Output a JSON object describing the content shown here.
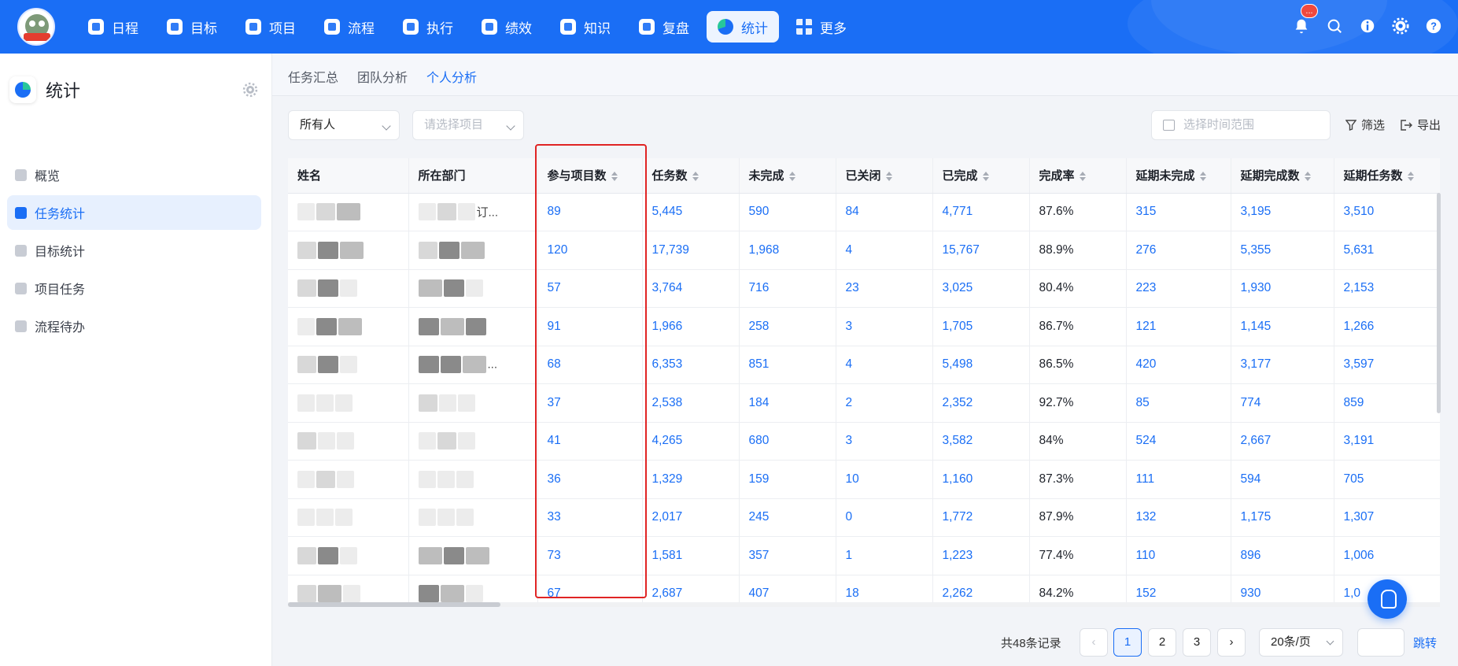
{
  "nav": {
    "items": [
      {
        "label": "日程",
        "icon": "calendar-icon"
      },
      {
        "label": "目标",
        "icon": "target-icon"
      },
      {
        "label": "项目",
        "icon": "cube-icon"
      },
      {
        "label": "流程",
        "icon": "flow-icon"
      },
      {
        "label": "执行",
        "icon": "checklist-icon"
      },
      {
        "label": "绩效",
        "icon": "performance-icon"
      },
      {
        "label": "知识",
        "icon": "book-icon"
      },
      {
        "label": "复盘",
        "icon": "review-icon"
      },
      {
        "label": "统计",
        "icon": "pie-chart-icon",
        "active": true
      },
      {
        "label": "更多",
        "icon": "grid-icon"
      }
    ],
    "badge": "..."
  },
  "sidebar": {
    "title": "统计",
    "items": [
      {
        "label": "概览"
      },
      {
        "label": "任务统计",
        "active": true
      },
      {
        "label": "目标统计"
      },
      {
        "label": "项目任务"
      },
      {
        "label": "流程待办"
      }
    ]
  },
  "tabs": [
    "任务汇总",
    "团队分析",
    "个人分析"
  ],
  "filters": {
    "person": "所有人",
    "project_placeholder": "请选择项目",
    "date_placeholder": "选择时间范围",
    "filter_label": "筛选",
    "export_label": "导出"
  },
  "table": {
    "columns": [
      "姓名",
      "所在部门",
      "参与项目数",
      "任务数",
      "未完成",
      "已关闭",
      "已完成",
      "完成率",
      "延期未完成",
      "延期完成数",
      "延期任务数"
    ],
    "rows": [
      {
        "dept_suffix": "订...",
        "projects": "89",
        "tasks": "5,445",
        "unfinished": "590",
        "closed": "84",
        "done": "4,771",
        "rate": "87.6%",
        "delay_unfinished": "315",
        "delay_done": "3,195",
        "delay_tasks": "3,510"
      },
      {
        "dept_suffix": "",
        "projects": "120",
        "tasks": "17,739",
        "unfinished": "1,968",
        "closed": "4",
        "done": "15,767",
        "rate": "88.9%",
        "delay_unfinished": "276",
        "delay_done": "5,355",
        "delay_tasks": "5,631"
      },
      {
        "dept_suffix": "",
        "projects": "57",
        "tasks": "3,764",
        "unfinished": "716",
        "closed": "23",
        "done": "3,025",
        "rate": "80.4%",
        "delay_unfinished": "223",
        "delay_done": "1,930",
        "delay_tasks": "2,153"
      },
      {
        "dept_suffix": "",
        "projects": "91",
        "tasks": "1,966",
        "unfinished": "258",
        "closed": "3",
        "done": "1,705",
        "rate": "86.7%",
        "delay_unfinished": "121",
        "delay_done": "1,145",
        "delay_tasks": "1,266"
      },
      {
        "dept_suffix": "...",
        "projects": "68",
        "tasks": "6,353",
        "unfinished": "851",
        "closed": "4",
        "done": "5,498",
        "rate": "86.5%",
        "delay_unfinished": "420",
        "delay_done": "3,177",
        "delay_tasks": "3,597"
      },
      {
        "dept_suffix": "",
        "projects": "37",
        "tasks": "2,538",
        "unfinished": "184",
        "closed": "2",
        "done": "2,352",
        "rate": "92.7%",
        "delay_unfinished": "85",
        "delay_done": "774",
        "delay_tasks": "859"
      },
      {
        "dept_suffix": "",
        "projects": "41",
        "tasks": "4,265",
        "unfinished": "680",
        "closed": "3",
        "done": "3,582",
        "rate": "84%",
        "delay_unfinished": "524",
        "delay_done": "2,667",
        "delay_tasks": "3,191"
      },
      {
        "dept_suffix": "",
        "projects": "36",
        "tasks": "1,329",
        "unfinished": "159",
        "closed": "10",
        "done": "1,160",
        "rate": "87.3%",
        "delay_unfinished": "111",
        "delay_done": "594",
        "delay_tasks": "705"
      },
      {
        "dept_suffix": "",
        "projects": "33",
        "tasks": "2,017",
        "unfinished": "245",
        "closed": "0",
        "done": "1,772",
        "rate": "87.9%",
        "delay_unfinished": "132",
        "delay_done": "1,175",
        "delay_tasks": "1,307"
      },
      {
        "dept_suffix": "",
        "projects": "73",
        "tasks": "1,581",
        "unfinished": "357",
        "closed": "1",
        "done": "1,223",
        "rate": "77.4%",
        "delay_unfinished": "110",
        "delay_done": "896",
        "delay_tasks": "1,006"
      },
      {
        "dept_suffix": "",
        "projects": "67",
        "tasks": "2,687",
        "unfinished": "407",
        "closed": "18",
        "done": "2,262",
        "rate": "84.2%",
        "delay_unfinished": "152",
        "delay_done": "930",
        "delay_tasks": "1,0"
      }
    ]
  },
  "pagination": {
    "total": "共48条记录",
    "prev": "‹",
    "pages": [
      "1",
      "2",
      "3"
    ],
    "next": "›",
    "page_size": "20条/页",
    "jump": "跳转"
  },
  "colors": {
    "accent": "#1a6ef5",
    "highlight": "#e02424"
  }
}
